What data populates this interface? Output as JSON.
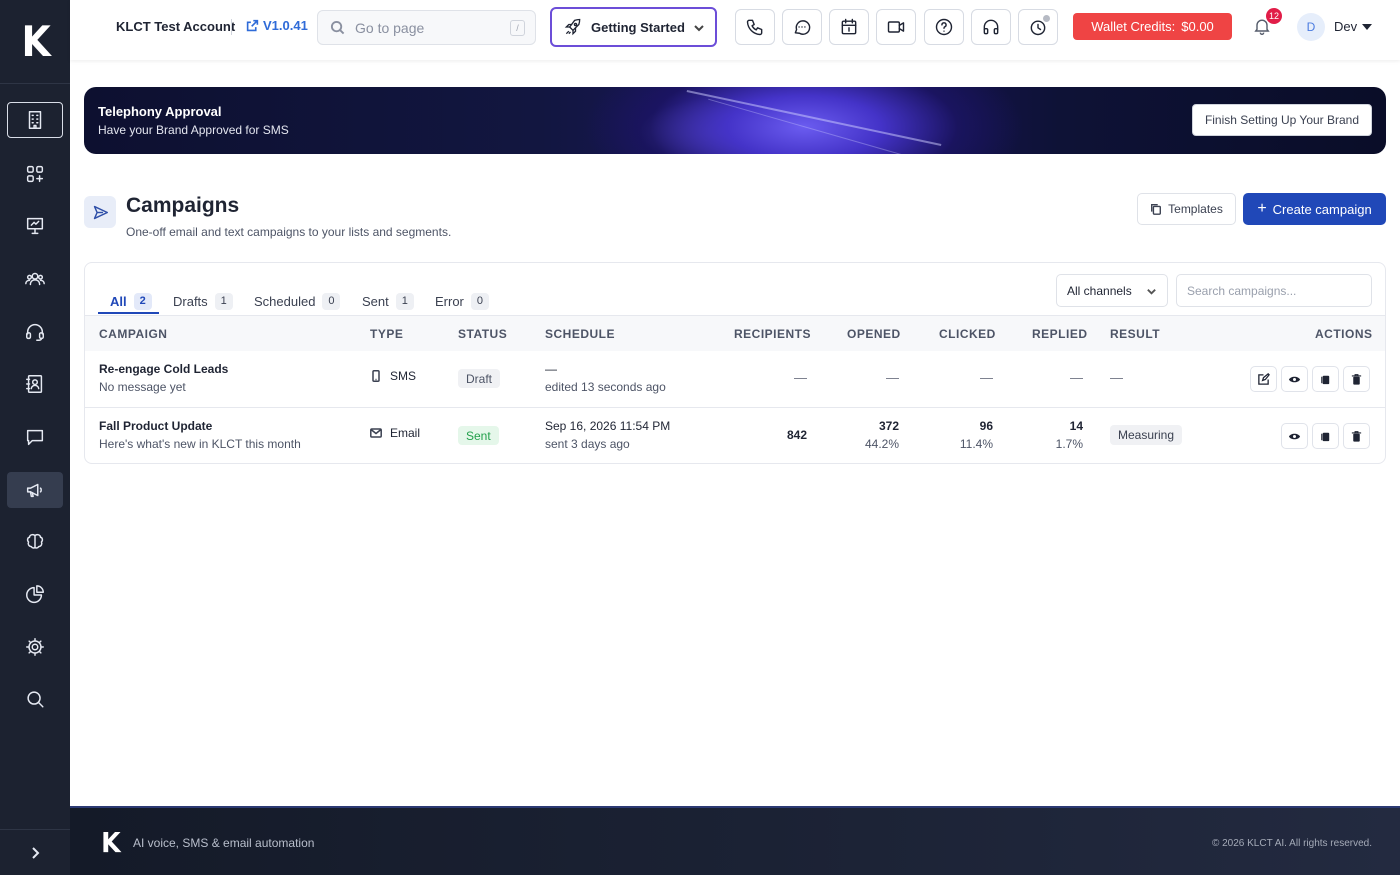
{
  "app": {
    "logo_letter": "K"
  },
  "header": {
    "account": "KLCT Test Account",
    "version": "V1.0.41",
    "goto_placeholder": "Go to page",
    "goto_shortcut": "/",
    "getting_started": "Getting Started",
    "wallet_label": "Wallet Credits:",
    "wallet_amount": "$0.00",
    "notification_count": "12",
    "user_initial": "D",
    "user_name": "Dev"
  },
  "banner": {
    "title": "Telephony Approval",
    "subtitle": "Have your Brand Approved for SMS",
    "button": "Finish Setting Up Your Brand"
  },
  "page": {
    "title": "Campaigns",
    "subtitle": "One-off email and text campaigns to your lists and segments.",
    "templates_button": "Templates",
    "create_button": "Create campaign"
  },
  "tabs": [
    {
      "label": "All",
      "count": "2"
    },
    {
      "label": "Drafts",
      "count": "1"
    },
    {
      "label": "Scheduled",
      "count": "0"
    },
    {
      "label": "Sent",
      "count": "1"
    },
    {
      "label": "Error",
      "count": "0"
    }
  ],
  "filters": {
    "channel": "All channels",
    "search_placeholder": "Search campaigns..."
  },
  "columns": {
    "campaign": "CAMPAIGN",
    "type": "TYPE",
    "status": "STATUS",
    "schedule": "SCHEDULE",
    "recipients": "RECIPIENTS",
    "opened": "OPENED",
    "clicked": "CLICKED",
    "replied": "REPLIED",
    "result": "RESULT",
    "actions": "ACTIONS"
  },
  "rows": [
    {
      "name": "Re-engage Cold Leads",
      "desc": "No message yet",
      "type": "SMS",
      "status": "Draft",
      "schedule": "—",
      "schedule_sub": "edited 13 seconds ago",
      "recipients": "—",
      "opened": "—",
      "clicked": "—",
      "replied": "—",
      "result": "—"
    },
    {
      "name": "Fall Product Update",
      "desc": "Here's what's new in KLCT this month",
      "type": "Email",
      "status": "Sent",
      "schedule": "Sep 16, 2026 11:54 PM",
      "schedule_sub": "sent 3 days ago",
      "recipients": "842",
      "opened": "372",
      "opened_pct": "44.2%",
      "clicked": "96",
      "clicked_pct": "11.4%",
      "replied": "14",
      "replied_pct": "1.7%",
      "result": "Measuring"
    }
  ],
  "footer": {
    "tagline": "AI voice, SMS & email automation",
    "copyright": "© 2026 KLCT AI. All rights reserved."
  },
  "colors": {
    "primary": "#2048b8",
    "wallet": "#ef4444",
    "sidebar": "#1c2230",
    "sent_green": "#22a04b"
  }
}
